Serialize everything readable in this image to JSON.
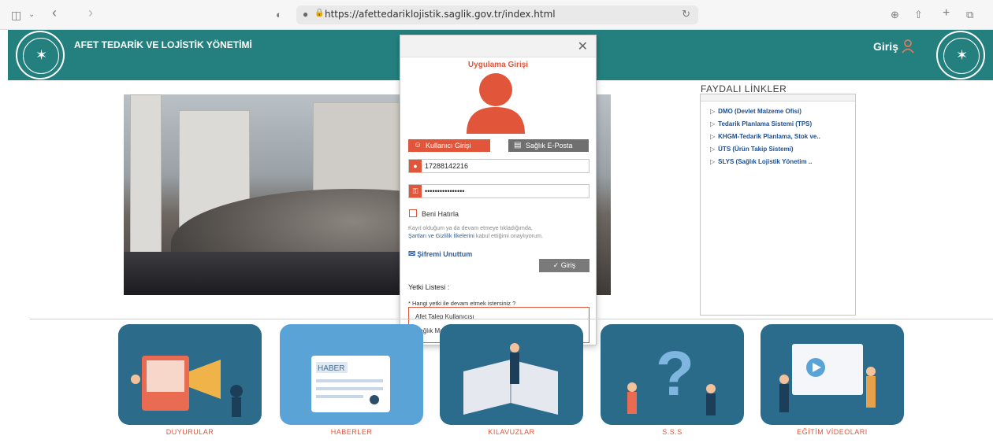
{
  "browser": {
    "url": "https://afettedariklojistik.saglik.gov.tr/index.html",
    "icons": [
      "sidebar-icon",
      "chevron-down-icon",
      "back-icon",
      "forward-icon",
      "shield-icon",
      "globe-icon",
      "lock-icon",
      "reload-icon",
      "download-icon",
      "share-icon",
      "plus-icon",
      "tabs-icon"
    ]
  },
  "header": {
    "title": "AFET TEDARİK VE LOJİSTİK YÖNETİMİ",
    "login_label": "Giriş",
    "color": "#24807f"
  },
  "modal": {
    "title": "Uygulama Girişi",
    "tab_user": "Kullanıcı Girişi",
    "tab_mail": "Sağlık E-Posta",
    "username_value": "17288142216",
    "password_value": "••••••••••••••••",
    "remember_label": "Beni Hatırla",
    "terms_prefix": "Kayıt olduğum ya da devam etmeye tıkladığımda,",
    "terms_link": "Şartları ve Gizlilik İlkelerini",
    "terms_suffix": "kabul ettiğimi onaylıyorum.",
    "forgot_label": "Şifremi Unuttum",
    "submit_label": "Giriş",
    "role_title": "Yetki Listesi :",
    "role_question": "* Hangi yetki ile devam etmek istersiniz ?",
    "roles": [
      "Afet Talep Kullanıcısı",
      "Sağlık Market Hastane Yetkilisi"
    ],
    "accent": "#e1553a"
  },
  "useful_links": {
    "title": "FAYDALI LİNKLER",
    "items": [
      "DMO (Devlet Malzeme Ofisi)",
      "Tedarik Planlama Sistemi (TPS)",
      "KHGM-Tedarik Planlama, Stok ve..",
      "ÜTS (Ürün Takip Sistemi)",
      "SLYS (Sağlık Lojistik Yönetim .."
    ]
  },
  "tiles": [
    {
      "label": "DUYURULAR"
    },
    {
      "label": "HABERLER",
      "art_text": "HABER"
    },
    {
      "label": "KILAVUZLAR"
    },
    {
      "label": "S.S.S"
    },
    {
      "label": "EĞİTİM VİDEOLARI"
    }
  ]
}
